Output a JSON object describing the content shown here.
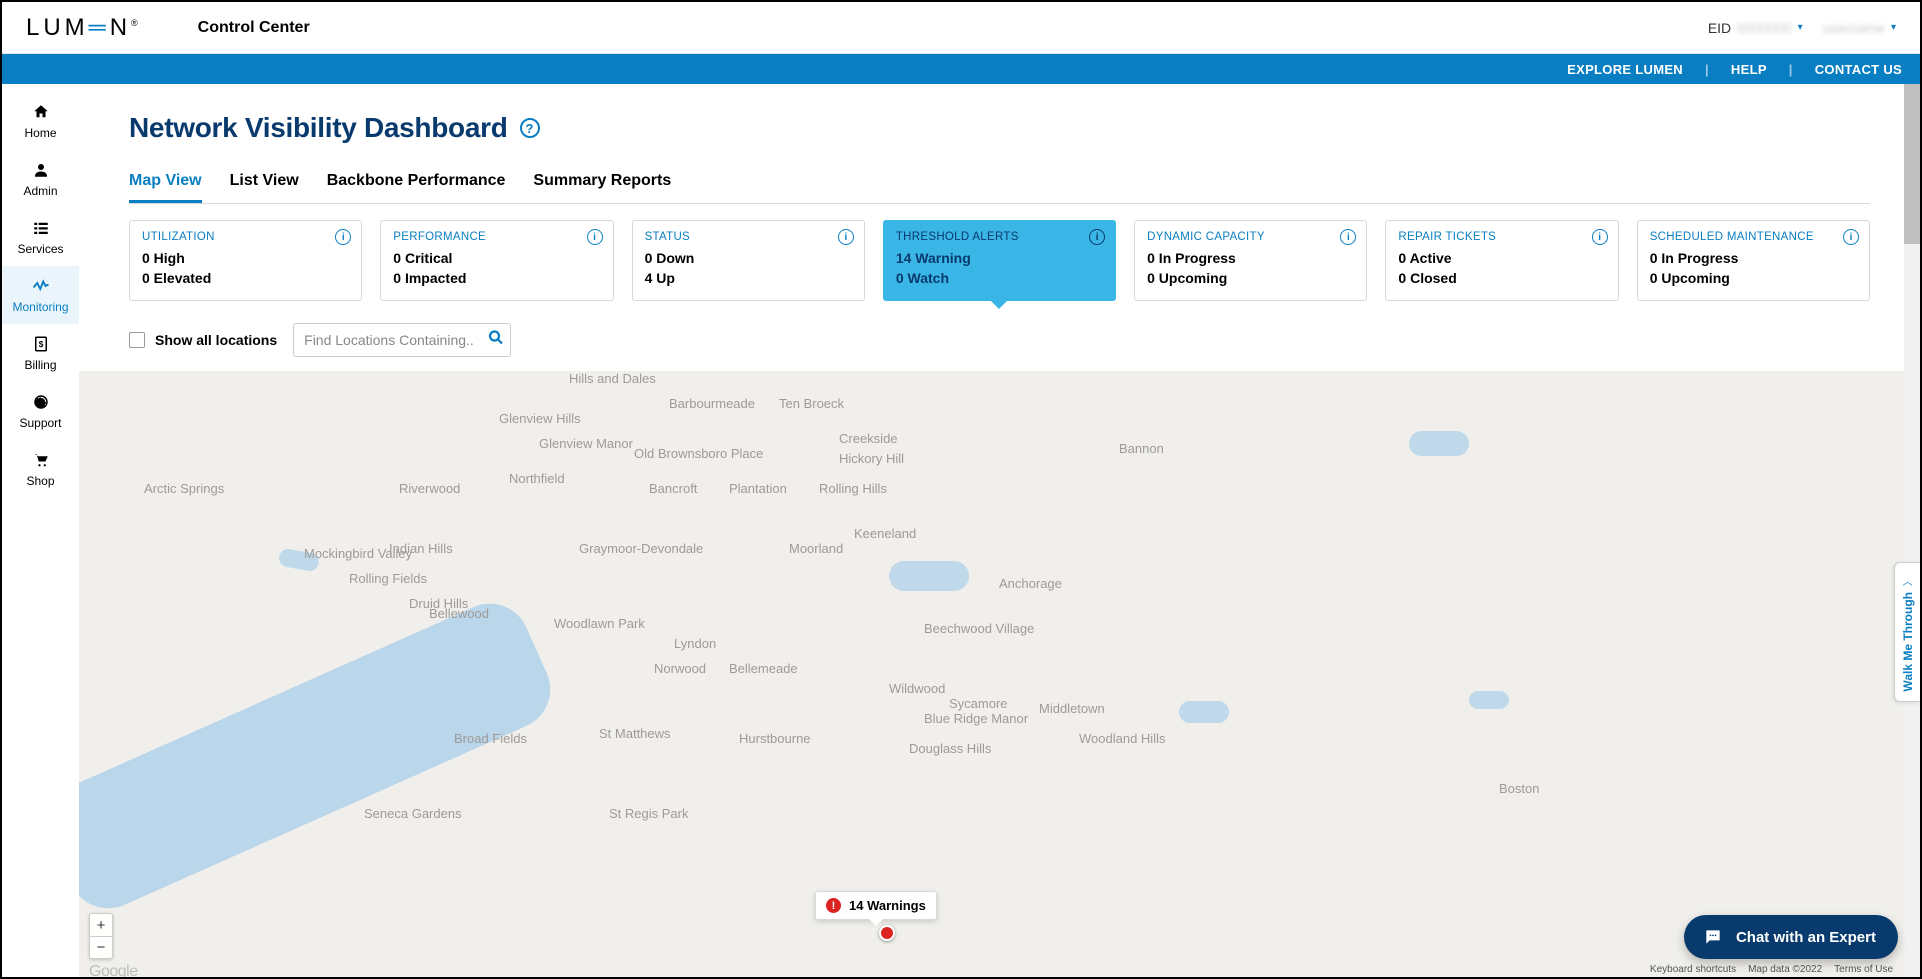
{
  "header": {
    "logo_parts": {
      "pre": "LUM",
      "mid": "E",
      "post": "N",
      "tm": "®"
    },
    "app_name": "Control Center",
    "eid_label": "EID",
    "eid_value": "0000000",
    "user_name": "username"
  },
  "utilbar": {
    "explore": "EXPLORE LUMEN",
    "help": "HELP",
    "contact": "CONTACT US"
  },
  "sidebar": {
    "items": [
      {
        "label": "Home",
        "icon": "home-icon"
      },
      {
        "label": "Admin",
        "icon": "admin-icon"
      },
      {
        "label": "Services",
        "icon": "services-icon"
      },
      {
        "label": "Monitoring",
        "icon": "monitoring-icon",
        "active": true
      },
      {
        "label": "Billing",
        "icon": "billing-icon"
      },
      {
        "label": "Support",
        "icon": "support-icon"
      },
      {
        "label": "Shop",
        "icon": "shop-icon"
      }
    ]
  },
  "page": {
    "title": "Network Visibility Dashboard",
    "tabs": [
      "Map View",
      "List View",
      "Backbone Performance",
      "Summary Reports"
    ],
    "active_tab": "Map View"
  },
  "cards": [
    {
      "title": "UTILIZATION",
      "lines": [
        "0 High",
        "0 Elevated"
      ]
    },
    {
      "title": "PERFORMANCE",
      "lines": [
        "0 Critical",
        "0 Impacted"
      ]
    },
    {
      "title": "STATUS",
      "lines": [
        "0 Down",
        "4 Up"
      ]
    },
    {
      "title": "THRESHOLD ALERTS",
      "lines": [
        "14 Warning",
        "0 Watch"
      ],
      "active": true
    },
    {
      "title": "DYNAMIC CAPACITY",
      "lines": [
        "0 In Progress",
        "0 Upcoming"
      ]
    },
    {
      "title": "REPAIR TICKETS",
      "lines": [
        "0 Active",
        "0 Closed"
      ]
    },
    {
      "title": "SCHEDULED MAINTENANCE",
      "lines": [
        "0 In Progress",
        "0 Upcoming"
      ]
    }
  ],
  "filters": {
    "show_all_label": "Show all locations",
    "search_placeholder": "Find Locations Containing..."
  },
  "map": {
    "tooltip_text": "14 Warnings",
    "places": [
      "Arctic Springs",
      "Riverwood",
      "Northfield",
      "Glenview Hills",
      "Glenview Manor",
      "Hills and Dales",
      "Barbourmeade",
      "Ten Broeck",
      "Creekside",
      "Bannon",
      "Old Brownsboro Place",
      "Hickory Hill",
      "Bancroft",
      "Plantation",
      "Rolling Hills",
      "Keeneland",
      "Moorland",
      "Graymoor-Devondale",
      "Mockingbird Valley",
      "Indian Hills",
      "Rolling Fields",
      "Druid Hills",
      "Bellewood",
      "Woodlawn Park",
      "Anchorage",
      "Lyndon",
      "Beechwood Village",
      "Norwood",
      "Bellemeade",
      "Wildwood",
      "Sycamore",
      "Middletown",
      "St Matthews",
      "Broad Fields",
      "Blue Ridge Manor",
      "Woodland Hills",
      "Hurstbourne",
      "Douglass Hills",
      "Boston",
      "Seneca Gardens",
      "St Regis Park"
    ],
    "attribution": {
      "shortcuts": "Keyboard shortcuts",
      "mapdata": "Map data ©2022",
      "terms": "Terms of Use"
    }
  },
  "chat_label": "Chat with an Expert",
  "walkme_label": "Walk Me Through"
}
